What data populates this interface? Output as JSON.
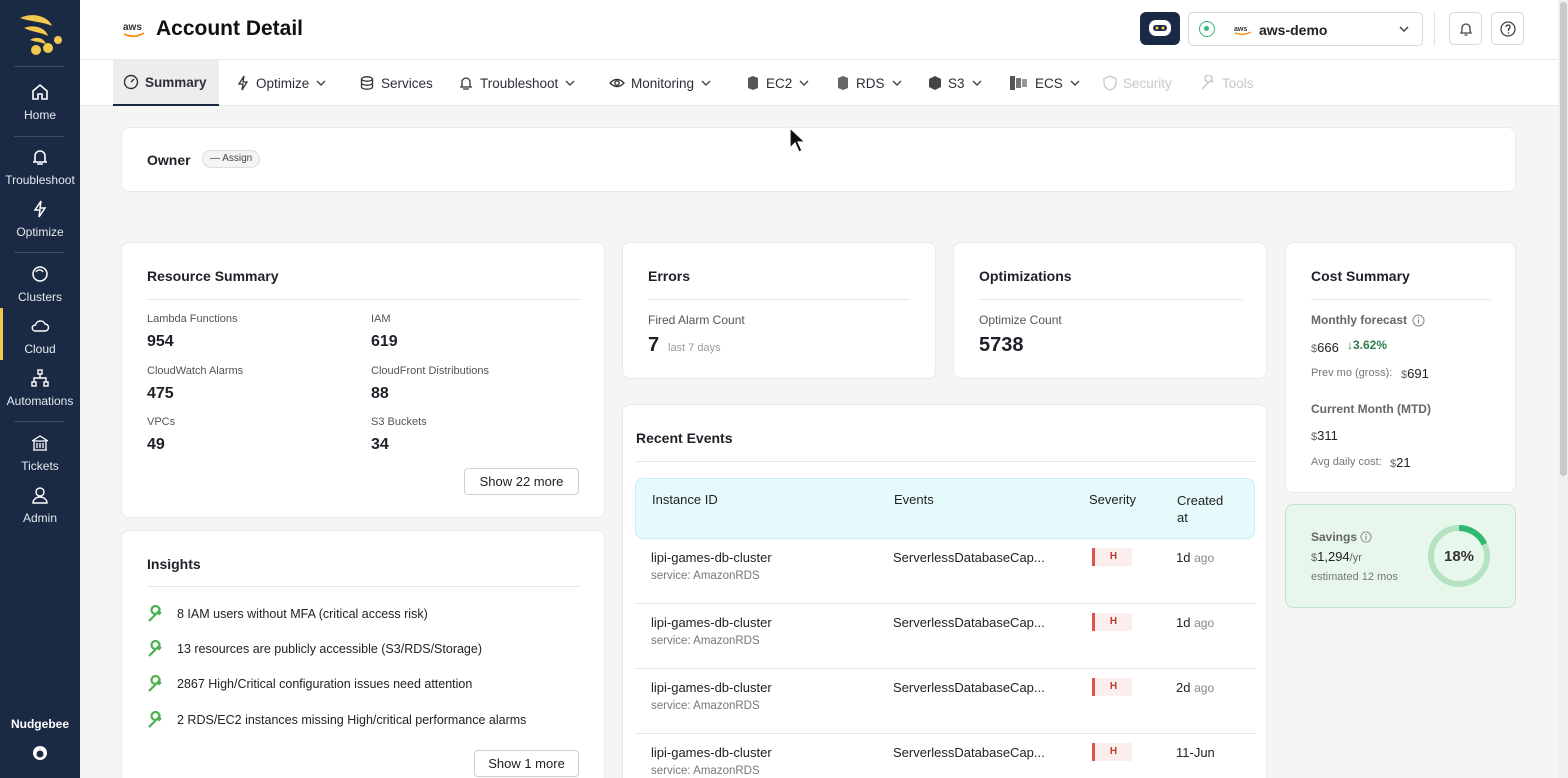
{
  "sidebar": {
    "items": [
      {
        "label": "Home",
        "icon": "home-icon"
      },
      {
        "label": "Troubleshoot",
        "icon": "troubleshoot-icon"
      },
      {
        "label": "Optimize",
        "icon": "bolt-icon"
      },
      {
        "label": "Clusters",
        "icon": "clusters-icon"
      },
      {
        "label": "Cloud",
        "icon": "cloud-icon",
        "active": true
      },
      {
        "label": "Automations",
        "icon": "automations-icon"
      },
      {
        "label": "Tickets",
        "icon": "tickets-icon"
      },
      {
        "label": "Admin",
        "icon": "admin-icon"
      }
    ],
    "brand": "Nudgebee"
  },
  "header": {
    "title": "Account Detail",
    "account": "aws-demo"
  },
  "tabs": [
    {
      "label": "Summary",
      "active": true
    },
    {
      "label": "Optimize"
    },
    {
      "label": "Services"
    },
    {
      "label": "Troubleshoot"
    },
    {
      "label": "Monitoring"
    },
    {
      "label": "EC2"
    },
    {
      "label": "RDS"
    },
    {
      "label": "S3"
    },
    {
      "label": "ECS"
    },
    {
      "label": "Security",
      "disabled": true
    },
    {
      "label": "Tools",
      "disabled": true
    }
  ],
  "owner": {
    "label": "Owner",
    "assign": "— Assign"
  },
  "resource_summary": {
    "title": "Resource Summary",
    "items": [
      {
        "label": "Lambda Functions",
        "value": "954"
      },
      {
        "label": "IAM",
        "value": "619"
      },
      {
        "label": "CloudWatch Alarms",
        "value": "475"
      },
      {
        "label": "CloudFront Distributions",
        "value": "88"
      },
      {
        "label": "VPCs",
        "value": "49"
      },
      {
        "label": "S3 Buckets",
        "value": "34"
      }
    ],
    "more": "Show 22 more"
  },
  "errors": {
    "title": "Errors",
    "label": "Fired Alarm Count",
    "value": "7",
    "period": "last 7 days"
  },
  "optimizations": {
    "title": "Optimizations",
    "label": "Optimize Count",
    "value": "5738"
  },
  "cost": {
    "title": "Cost Summary",
    "forecast_label": "Monthly forecast",
    "currency": "$",
    "forecast_value": "666",
    "forecast_change": "↓3.62%",
    "prev_label": "Prev mo (gross):",
    "prev_value": "691",
    "mtd_label": "Current Month (MTD)",
    "mtd_value": "311",
    "avg_label": "Avg daily cost:",
    "avg_value": "21"
  },
  "savings": {
    "label": "Savings",
    "value": "1,294",
    "unit": "/yr",
    "note": "estimated 12 mos",
    "percent": "18%",
    "fraction": 0.18
  },
  "insights": {
    "title": "Insights",
    "items": [
      "8 IAM users without MFA (critical access risk)",
      "13 resources are publicly accessible (S3/RDS/Storage)",
      "2867 High/Critical configuration issues need attention",
      "2 RDS/EC2 instances missing High/critical performance alarms"
    ],
    "more": "Show 1 more"
  },
  "events": {
    "title": "Recent Events",
    "columns": [
      "Instance ID",
      "Events",
      "Severity",
      "Created at"
    ],
    "rows": [
      {
        "id": "lipi-games-db-cluster",
        "service": "service: AmazonRDS",
        "event": "ServerlessDatabaseCap...",
        "severity": "H",
        "created": "1d",
        "ago": "ago"
      },
      {
        "id": "lipi-games-db-cluster",
        "service": "service: AmazonRDS",
        "event": "ServerlessDatabaseCap...",
        "severity": "H",
        "created": "1d",
        "ago": "ago"
      },
      {
        "id": "lipi-games-db-cluster",
        "service": "service: AmazonRDS",
        "event": "ServerlessDatabaseCap...",
        "severity": "H",
        "created": "2d",
        "ago": "ago"
      },
      {
        "id": "lipi-games-db-cluster",
        "service": "service: AmazonRDS",
        "event": "ServerlessDatabaseCap...",
        "severity": "H",
        "created": "11-Jun",
        "ago": ""
      }
    ]
  },
  "colors": {
    "sidebar": "#1b2a44",
    "accent": "#f2c94c",
    "green": "#2eb872",
    "severity": "#d9534f"
  }
}
